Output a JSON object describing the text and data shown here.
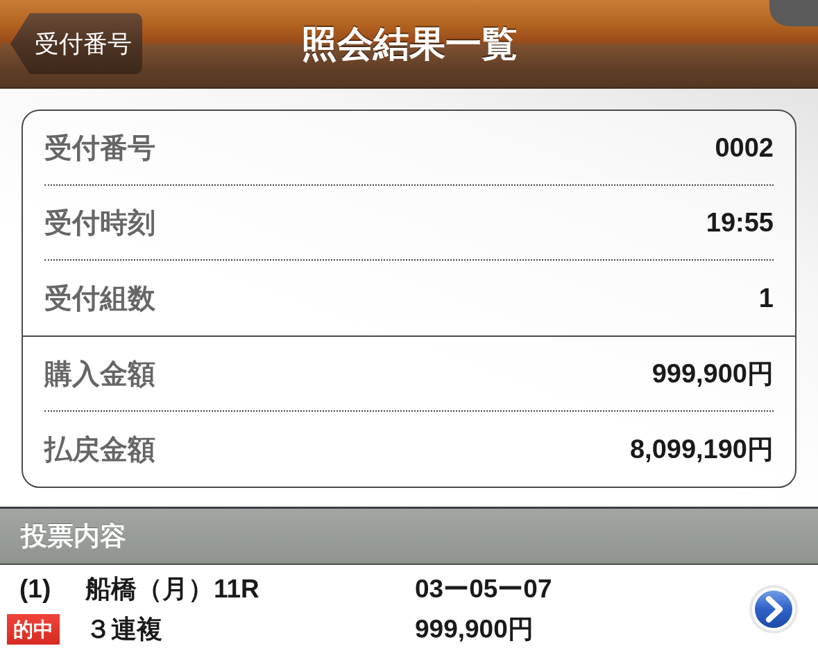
{
  "nav_bar": {
    "back_button": "受付番号",
    "title": "照会結果一覧"
  },
  "summary": {
    "groups": [
      {
        "rows": [
          {
            "label": "受付番号",
            "value": "0002"
          },
          {
            "label": "受付時刻",
            "value": "19:55"
          },
          {
            "label": "受付組数",
            "value": "1"
          }
        ]
      },
      {
        "rows": [
          {
            "label": "購入金額",
            "value": "999,900円"
          },
          {
            "label": "払戻金額",
            "value": "8,099,190円"
          }
        ]
      }
    ]
  },
  "section": {
    "title": "投票内容"
  },
  "bets": [
    {
      "index": "(1)",
      "race": "船橋（月）11R",
      "combination": "03ー05ー07",
      "badge": "的中",
      "bet_type": "３連複",
      "amount": "999,900円"
    }
  ]
}
